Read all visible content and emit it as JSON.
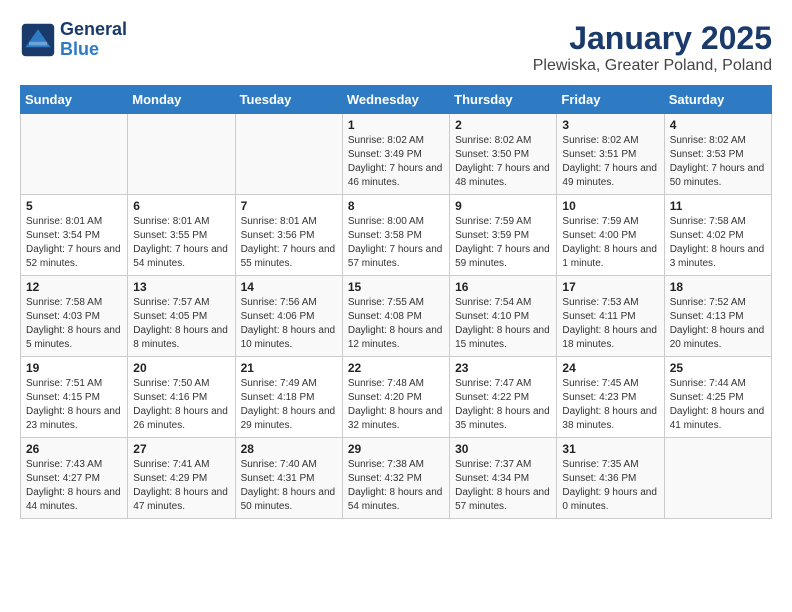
{
  "logo": {
    "line1": "General",
    "line2": "Blue"
  },
  "title": "January 2025",
  "subtitle": "Plewiska, Greater Poland, Poland",
  "weekdays": [
    "Sunday",
    "Monday",
    "Tuesday",
    "Wednesday",
    "Thursday",
    "Friday",
    "Saturday"
  ],
  "days": [
    {
      "num": "",
      "info": "",
      "empty": true
    },
    {
      "num": "",
      "info": "",
      "empty": true
    },
    {
      "num": "",
      "info": "",
      "empty": true
    },
    {
      "num": "1",
      "info": "Sunrise: 8:02 AM\nSunset: 3:49 PM\nDaylight: 7 hours and 46 minutes."
    },
    {
      "num": "2",
      "info": "Sunrise: 8:02 AM\nSunset: 3:50 PM\nDaylight: 7 hours and 48 minutes."
    },
    {
      "num": "3",
      "info": "Sunrise: 8:02 AM\nSunset: 3:51 PM\nDaylight: 7 hours and 49 minutes."
    },
    {
      "num": "4",
      "info": "Sunrise: 8:02 AM\nSunset: 3:53 PM\nDaylight: 7 hours and 50 minutes."
    },
    {
      "num": "5",
      "info": "Sunrise: 8:01 AM\nSunset: 3:54 PM\nDaylight: 7 hours and 52 minutes."
    },
    {
      "num": "6",
      "info": "Sunrise: 8:01 AM\nSunset: 3:55 PM\nDaylight: 7 hours and 54 minutes."
    },
    {
      "num": "7",
      "info": "Sunrise: 8:01 AM\nSunset: 3:56 PM\nDaylight: 7 hours and 55 minutes."
    },
    {
      "num": "8",
      "info": "Sunrise: 8:00 AM\nSunset: 3:58 PM\nDaylight: 7 hours and 57 minutes."
    },
    {
      "num": "9",
      "info": "Sunrise: 7:59 AM\nSunset: 3:59 PM\nDaylight: 7 hours and 59 minutes."
    },
    {
      "num": "10",
      "info": "Sunrise: 7:59 AM\nSunset: 4:00 PM\nDaylight: 8 hours and 1 minute."
    },
    {
      "num": "11",
      "info": "Sunrise: 7:58 AM\nSunset: 4:02 PM\nDaylight: 8 hours and 3 minutes."
    },
    {
      "num": "12",
      "info": "Sunrise: 7:58 AM\nSunset: 4:03 PM\nDaylight: 8 hours and 5 minutes."
    },
    {
      "num": "13",
      "info": "Sunrise: 7:57 AM\nSunset: 4:05 PM\nDaylight: 8 hours and 8 minutes."
    },
    {
      "num": "14",
      "info": "Sunrise: 7:56 AM\nSunset: 4:06 PM\nDaylight: 8 hours and 10 minutes."
    },
    {
      "num": "15",
      "info": "Sunrise: 7:55 AM\nSunset: 4:08 PM\nDaylight: 8 hours and 12 minutes."
    },
    {
      "num": "16",
      "info": "Sunrise: 7:54 AM\nSunset: 4:10 PM\nDaylight: 8 hours and 15 minutes."
    },
    {
      "num": "17",
      "info": "Sunrise: 7:53 AM\nSunset: 4:11 PM\nDaylight: 8 hours and 18 minutes."
    },
    {
      "num": "18",
      "info": "Sunrise: 7:52 AM\nSunset: 4:13 PM\nDaylight: 8 hours and 20 minutes."
    },
    {
      "num": "19",
      "info": "Sunrise: 7:51 AM\nSunset: 4:15 PM\nDaylight: 8 hours and 23 minutes."
    },
    {
      "num": "20",
      "info": "Sunrise: 7:50 AM\nSunset: 4:16 PM\nDaylight: 8 hours and 26 minutes."
    },
    {
      "num": "21",
      "info": "Sunrise: 7:49 AM\nSunset: 4:18 PM\nDaylight: 8 hours and 29 minutes."
    },
    {
      "num": "22",
      "info": "Sunrise: 7:48 AM\nSunset: 4:20 PM\nDaylight: 8 hours and 32 minutes."
    },
    {
      "num": "23",
      "info": "Sunrise: 7:47 AM\nSunset: 4:22 PM\nDaylight: 8 hours and 35 minutes."
    },
    {
      "num": "24",
      "info": "Sunrise: 7:45 AM\nSunset: 4:23 PM\nDaylight: 8 hours and 38 minutes."
    },
    {
      "num": "25",
      "info": "Sunrise: 7:44 AM\nSunset: 4:25 PM\nDaylight: 8 hours and 41 minutes."
    },
    {
      "num": "26",
      "info": "Sunrise: 7:43 AM\nSunset: 4:27 PM\nDaylight: 8 hours and 44 minutes."
    },
    {
      "num": "27",
      "info": "Sunrise: 7:41 AM\nSunset: 4:29 PM\nDaylight: 8 hours and 47 minutes."
    },
    {
      "num": "28",
      "info": "Sunrise: 7:40 AM\nSunset: 4:31 PM\nDaylight: 8 hours and 50 minutes."
    },
    {
      "num": "29",
      "info": "Sunrise: 7:38 AM\nSunset: 4:32 PM\nDaylight: 8 hours and 54 minutes."
    },
    {
      "num": "30",
      "info": "Sunrise: 7:37 AM\nSunset: 4:34 PM\nDaylight: 8 hours and 57 minutes."
    },
    {
      "num": "31",
      "info": "Sunrise: 7:35 AM\nSunset: 4:36 PM\nDaylight: 9 hours and 0 minutes."
    },
    {
      "num": "",
      "info": "",
      "empty": true
    }
  ]
}
